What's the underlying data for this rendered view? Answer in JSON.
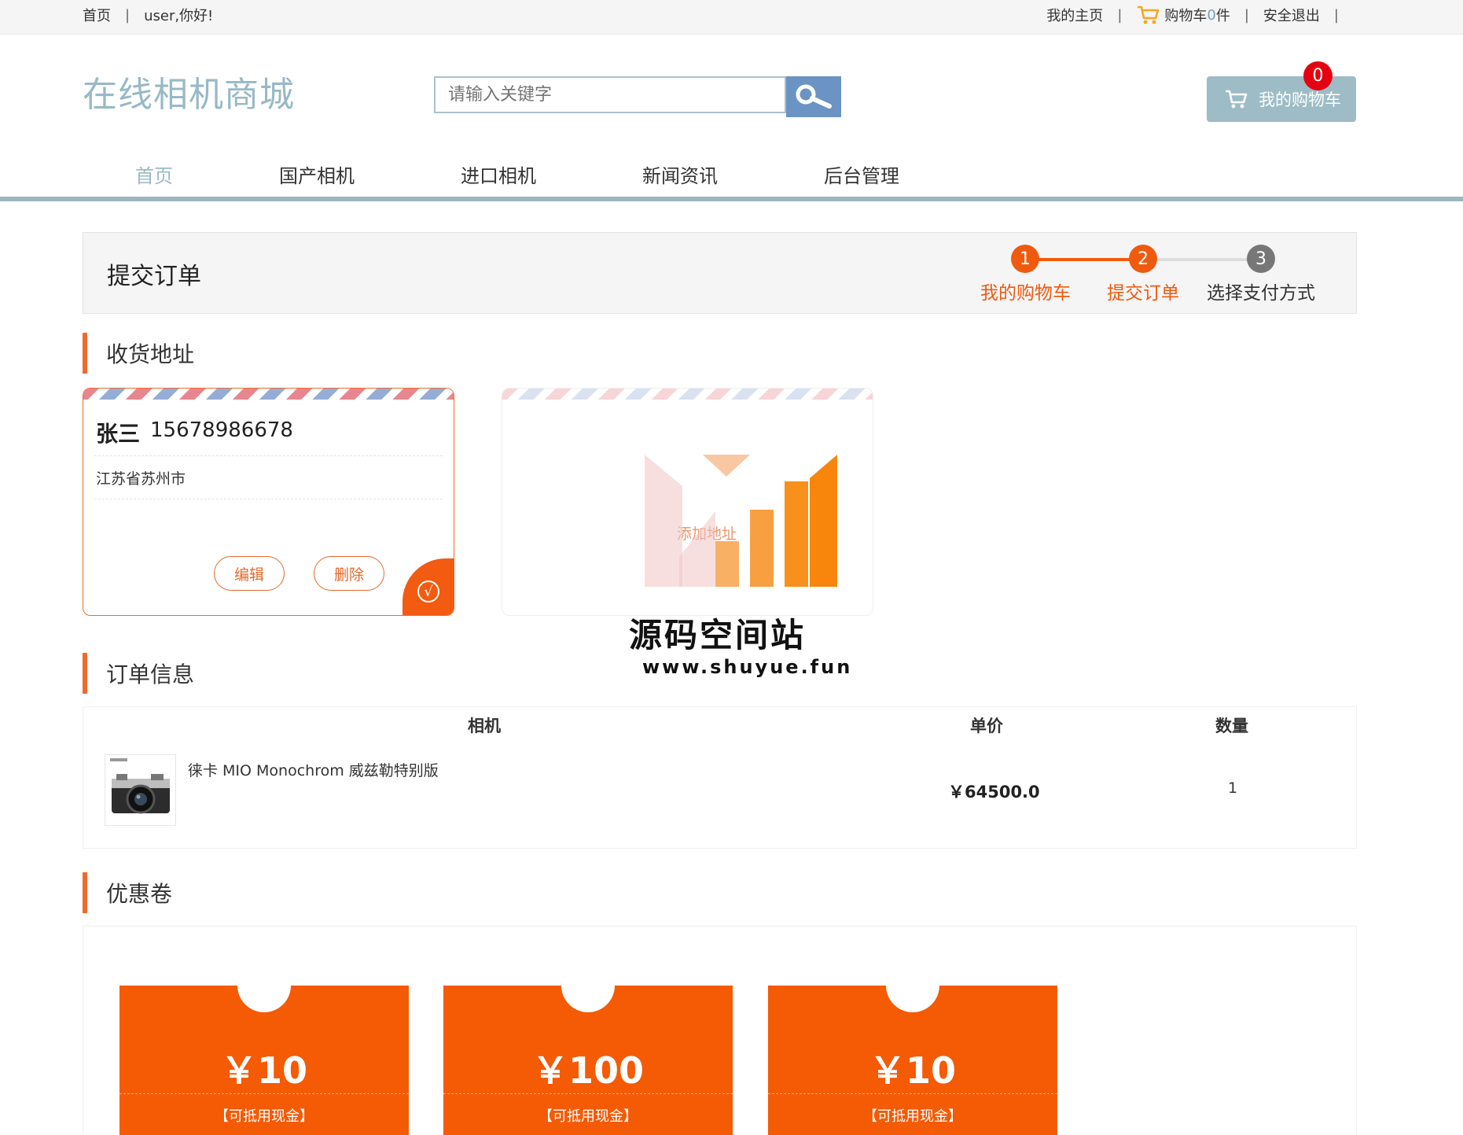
{
  "topbar": {
    "home": "首页",
    "greeting": "user,你好!",
    "my_home": "我的主页",
    "cart_prefix": "购物车",
    "cart_count": "0",
    "cart_suffix": "件",
    "logout": "安全退出"
  },
  "header": {
    "logo": "在线相机商城",
    "search_placeholder": "请输入关键字",
    "my_cart_label": "我的购物车",
    "cart_badge": "0"
  },
  "nav": {
    "items": [
      {
        "label": "首页",
        "active": true
      },
      {
        "label": "国产相机",
        "active": false
      },
      {
        "label": "进口相机",
        "active": false
      },
      {
        "label": "新闻资讯",
        "active": false
      },
      {
        "label": "后台管理",
        "active": false
      }
    ]
  },
  "steps": {
    "page_title": "提交订单",
    "items": [
      {
        "num": "1",
        "label": "我的购物车",
        "done": true
      },
      {
        "num": "2",
        "label": "提交订单",
        "done": true
      },
      {
        "num": "3",
        "label": "选择支付方式",
        "done": false
      }
    ],
    "colors": {
      "done": "#f05a0f",
      "todo": "#777777"
    }
  },
  "address": {
    "heading": "收货地址",
    "selected": {
      "name": "张三",
      "phone": "15678986678",
      "address": "江苏省苏州市",
      "edit_label": "编辑",
      "delete_label": "删除",
      "check_icon": "√"
    },
    "add_card": {
      "label": "添加地址"
    }
  },
  "watermark": {
    "title": "源码空间站",
    "url": "www.shuyue.fun"
  },
  "order": {
    "heading": "订单信息",
    "columns": [
      "相机",
      "单价",
      "数量"
    ],
    "rows": [
      {
        "name": "徕卡 MIO Monochrom 威兹勒特别版",
        "price": "￥64500.0",
        "qty": "1"
      }
    ]
  },
  "coupons": {
    "heading": "优惠卷",
    "items": [
      {
        "amount": "￥10",
        "desc": "【可抵用现金】"
      },
      {
        "amount": "￥100",
        "desc": "【可抵用现金】"
      },
      {
        "amount": "￥10",
        "desc": "【可抵用现金】"
      }
    ],
    "color": "#f55a05"
  },
  "accent": "#f06a2d"
}
